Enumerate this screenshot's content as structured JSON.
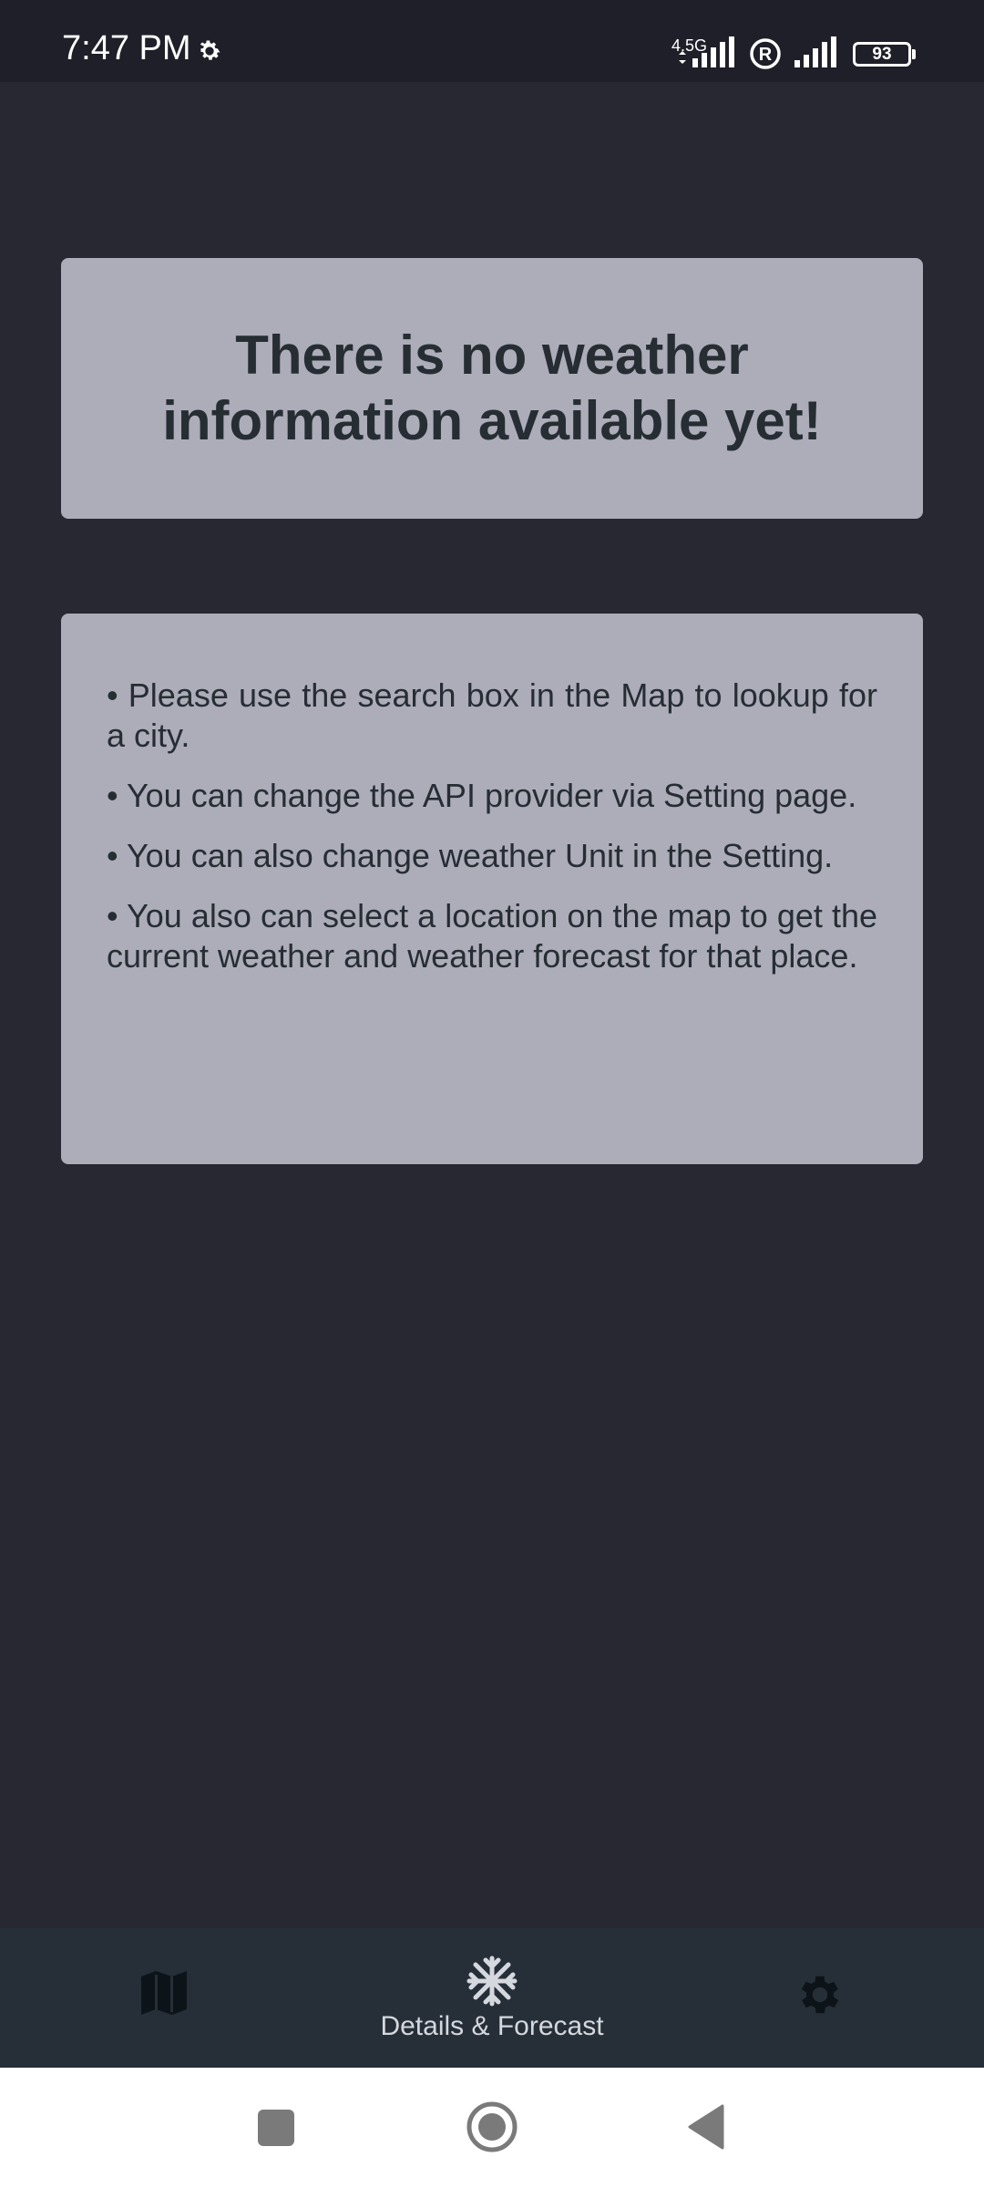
{
  "status_bar": {
    "time": "7:47 PM",
    "network_type": "4.5G",
    "battery_level": "93",
    "icons": [
      "settings-gear-icon",
      "signal-icon",
      "registered-icon",
      "signal-icon",
      "battery-icon"
    ]
  },
  "title_card": {
    "text": "There is no weather information available yet!"
  },
  "info_card": {
    "lines": [
      "• Please use the search box in the Map to lookup for a city.",
      "• You can change the API provider via Setting page.",
      "• You can also change weather Unit in the Setting.",
      "• You also can select a location on the map to get the current weather and weather forecast for that place."
    ]
  },
  "bottom_nav": {
    "map_icon": "map-icon",
    "details_label": "Details & Forecast",
    "details_icon": "snowflake-icon",
    "settings_icon": "gear-icon"
  },
  "system_nav": {
    "icons": [
      "recents-square-icon",
      "home-circle-icon",
      "back-triangle-icon"
    ]
  },
  "colors": {
    "background": "#272832",
    "card": "#adadba",
    "card_text": "#262d33",
    "bottom_nav": "#262f38",
    "status_bar": "#1e1f28"
  }
}
